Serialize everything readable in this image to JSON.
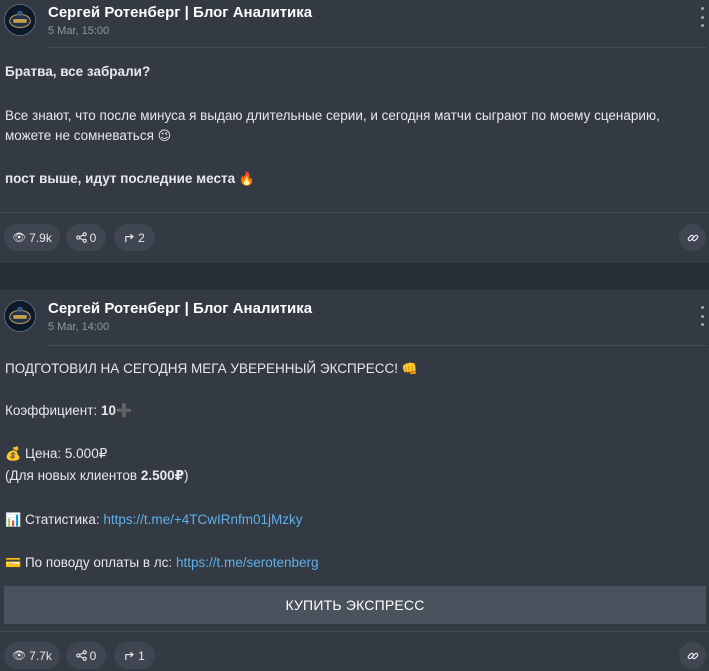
{
  "posts": [
    {
      "channel_name": "Сергей Ротенберг | Блог Аналитика",
      "date": "5 Mar, 15:00",
      "lines": {
        "l1": "Братва, все забрали?",
        "l2": "Все знают, что после минуса я выдаю длительные серии, и сегодня матчи сыграют по моему сценарию,",
        "l3": "можете не сомневаться",
        "l3_emoji": "😉",
        "l4": "пост выше, идут последние места",
        "l4_emoji": "🔥"
      },
      "stats": {
        "views": "7.9k",
        "reactions": "0",
        "shares": "2"
      }
    },
    {
      "channel_name": "Сергей Ротенберг | Блог Аналитика",
      "date": "5 Mar, 14:00",
      "lines": {
        "l1": "ПОДГОТОВИЛ НА СЕГОДНЯ МЕГА УВЕРЕННЫЙ ЭКСПРЕСС!",
        "l1_emoji": "👊",
        "coef_label": "Коэффициент:",
        "coef_value": "10",
        "coef_emoji": "➕",
        "price_emoji": "💰",
        "price": "Цена: 5.000₽",
        "new_clients_prefix": "(Для новых клиентов",
        "new_clients_value": "2.500₽",
        "new_clients_suffix": ")",
        "stats_emoji": "📊",
        "stats_label": "Статистика:",
        "stats_link": "https://t.me/+4TCwIRnfm01jMzky",
        "pay_emoji": "💳",
        "pay_label": "По поводу оплаты в лс:",
        "pay_link": "https://t.me/serotenberg"
      },
      "button_label": "КУПИТЬ ЭКСПРЕСС",
      "stats": {
        "views": "7.7k",
        "reactions": "0",
        "shares": "1"
      }
    }
  ],
  "icons": {
    "views": "eye-icon",
    "reactions": "share-nodes-icon",
    "shares": "forward-arrow-icon",
    "link": "link-icon",
    "more": "more-vertical-icon"
  },
  "colors": {
    "background": "#2e3440",
    "card": "#333a44",
    "pill": "#3f4651",
    "link": "#5fb0e8",
    "button": "#4a525e"
  }
}
